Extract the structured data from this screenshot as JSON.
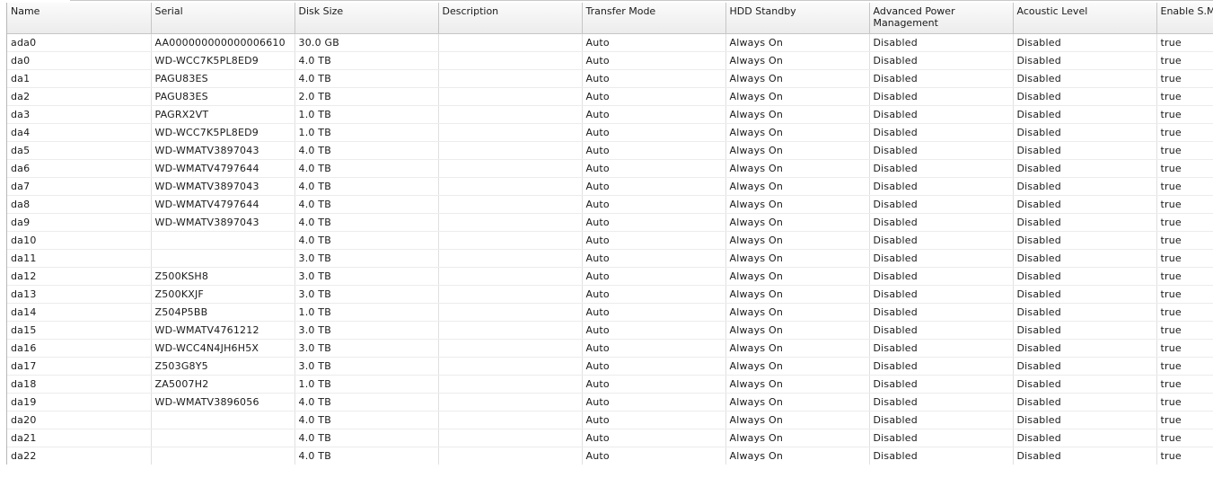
{
  "columns": [
    "Name",
    "Serial",
    "Disk Size",
    "Description",
    "Transfer Mode",
    "HDD Standby",
    "Advanced Power Management",
    "Acoustic Level",
    "Enable S.M"
  ],
  "rows": [
    [
      "ada0",
      "AA000000000000006610",
      "30.0 GB",
      "",
      "Auto",
      "Always On",
      "Disabled",
      "Disabled",
      "true"
    ],
    [
      "da0",
      "WD-WCC7K5PL8ED9",
      "4.0 TB",
      "",
      "Auto",
      "Always On",
      "Disabled",
      "Disabled",
      "true"
    ],
    [
      "da1",
      "PAGU83ES",
      "4.0 TB",
      "",
      "Auto",
      "Always On",
      "Disabled",
      "Disabled",
      "true"
    ],
    [
      "da2",
      "PAGU83ES",
      "2.0 TB",
      "",
      "Auto",
      "Always On",
      "Disabled",
      "Disabled",
      "true"
    ],
    [
      "da3",
      "PAGRX2VT",
      "1.0 TB",
      "",
      "Auto",
      "Always On",
      "Disabled",
      "Disabled",
      "true"
    ],
    [
      "da4",
      "WD-WCC7K5PL8ED9",
      "1.0 TB",
      "",
      "Auto",
      "Always On",
      "Disabled",
      "Disabled",
      "true"
    ],
    [
      "da5",
      "WD-WMATV3897043",
      "4.0 TB",
      "",
      "Auto",
      "Always On",
      "Disabled",
      "Disabled",
      "true"
    ],
    [
      "da6",
      "WD-WMATV4797644",
      "4.0 TB",
      "",
      "Auto",
      "Always On",
      "Disabled",
      "Disabled",
      "true"
    ],
    [
      "da7",
      "WD-WMATV3897043",
      "4.0 TB",
      "",
      "Auto",
      "Always On",
      "Disabled",
      "Disabled",
      "true"
    ],
    [
      "da8",
      "WD-WMATV4797644",
      "4.0 TB",
      "",
      "Auto",
      "Always On",
      "Disabled",
      "Disabled",
      "true"
    ],
    [
      "da9",
      "WD-WMATV3897043",
      "4.0 TB",
      "",
      "Auto",
      "Always On",
      "Disabled",
      "Disabled",
      "true"
    ],
    [
      "da10",
      "",
      "4.0 TB",
      "",
      "Auto",
      "Always On",
      "Disabled",
      "Disabled",
      "true"
    ],
    [
      "da11",
      "",
      "3.0 TB",
      "",
      "Auto",
      "Always On",
      "Disabled",
      "Disabled",
      "true"
    ],
    [
      "da12",
      "Z500KSH8",
      "3.0 TB",
      "",
      "Auto",
      "Always On",
      "Disabled",
      "Disabled",
      "true"
    ],
    [
      "da13",
      "Z500KXJF",
      "3.0 TB",
      "",
      "Auto",
      "Always On",
      "Disabled",
      "Disabled",
      "true"
    ],
    [
      "da14",
      "Z504P5BB",
      "1.0 TB",
      "",
      "Auto",
      "Always On",
      "Disabled",
      "Disabled",
      "true"
    ],
    [
      "da15",
      "WD-WMATV4761212",
      "3.0 TB",
      "",
      "Auto",
      "Always On",
      "Disabled",
      "Disabled",
      "true"
    ],
    [
      "da16",
      "WD-WCC4N4JH6H5X",
      "3.0 TB",
      "",
      "Auto",
      "Always On",
      "Disabled",
      "Disabled",
      "true"
    ],
    [
      "da17",
      "Z503G8Y5",
      "3.0 TB",
      "",
      "Auto",
      "Always On",
      "Disabled",
      "Disabled",
      "true"
    ],
    [
      "da18",
      "ZA5007H2",
      "1.0 TB",
      "",
      "Auto",
      "Always On",
      "Disabled",
      "Disabled",
      "true"
    ],
    [
      "da19",
      "WD-WMATV3896056",
      "4.0 TB",
      "",
      "Auto",
      "Always On",
      "Disabled",
      "Disabled",
      "true"
    ],
    [
      "da20",
      "",
      "4.0 TB",
      "",
      "Auto",
      "Always On",
      "Disabled",
      "Disabled",
      "true"
    ],
    [
      "da21",
      "",
      "4.0 TB",
      "",
      "Auto",
      "Always On",
      "Disabled",
      "Disabled",
      "true"
    ],
    [
      "da22",
      "",
      "4.0 TB",
      "",
      "Auto",
      "Always On",
      "Disabled",
      "Disabled",
      "true"
    ]
  ]
}
